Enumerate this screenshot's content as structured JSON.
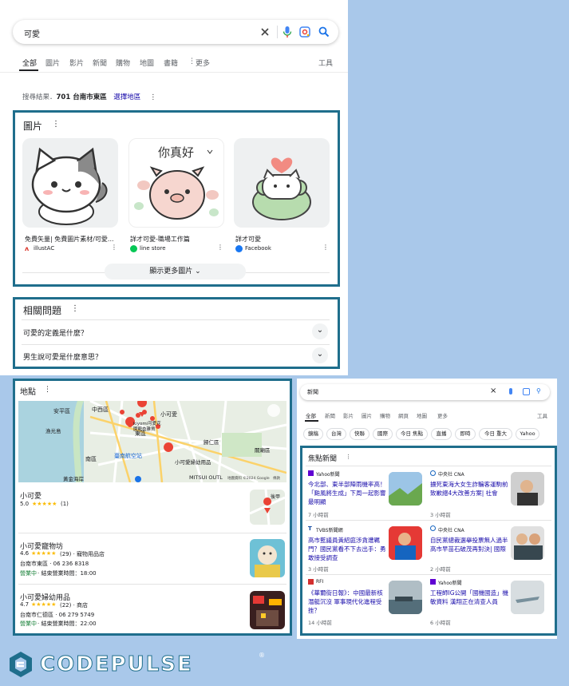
{
  "search": {
    "query": "可愛"
  },
  "tabs": [
    {
      "label": "全部"
    },
    {
      "label": "圖片"
    },
    {
      "label": "影片"
    },
    {
      "label": "新聞"
    },
    {
      "label": "購物"
    },
    {
      "label": "地圖"
    },
    {
      "label": "書籍"
    },
    {
      "label": "更多"
    }
  ],
  "tools_label": "工具",
  "location": {
    "prefix": "搜尋結果．",
    "place": "701 台南市東區",
    "change": "選擇地區"
  },
  "images": {
    "heading": "圖片",
    "cards": [
      {
        "title": "免費矢量| 免費圖片素材/可愛...",
        "source": "illustAC",
        "art_text": ""
      },
      {
        "title": "詳才可愛-職場工作篇",
        "source": "line store",
        "art_text": "你真好"
      },
      {
        "title": "詳才可愛",
        "source": "Facebook",
        "art_text": ""
      }
    ],
    "more": "顯示更多圖片"
  },
  "questions": {
    "heading": "相關問題",
    "items": [
      {
        "q": "可愛的定義是什麼？"
      },
      {
        "q": "男生說可愛是什麼意思？"
      }
    ]
  },
  "places": {
    "heading": "地點",
    "map_labels": [
      "安平區",
      "中西區",
      "小可愛",
      "東區",
      "漁光島",
      "kiyomi可愛花園寵衣雜貨",
      "臺南航空站",
      "南區",
      "小可愛婦幼用品",
      "關廟區",
      "歸仁區",
      "黃金海岸",
      "MITSUI OUTL"
    ],
    "map_footer": "地圖資料 ©2024 Google　條款",
    "items": [
      {
        "name": "小可愛",
        "rating": "5.0",
        "stars": "★★★★★",
        "count": "(1)",
        "lines": [],
        "open": "",
        "hours": "",
        "thumb_text": "後甲"
      },
      {
        "name": "小可愛寵物坊",
        "rating": "4.6",
        "stars": "★★★★★",
        "count": "(29) · 寵物用品店",
        "lines": [
          "台南市東區 · 06 236 8318"
        ],
        "open": "營業中",
        "hours": " · 結束營業時間：18:00",
        "thumb_text": ""
      },
      {
        "name": "小可愛婦幼用品",
        "rating": "4.7",
        "stars": "★★★★★",
        "count": "(22) · 商店",
        "lines": [
          "台南市仁德區 · 06 279 5749"
        ],
        "open": "營業中",
        "hours": " · 結束營業時間：22:00",
        "thumb_text": ""
      }
    ]
  },
  "news_panel": {
    "query": "新聞",
    "tabs": [
      "全部",
      "新聞",
      "影片",
      "圖片",
      "購物",
      "網頁",
      "地圖",
      "更多"
    ],
    "tools": "工具",
    "chips": [
      "鏡稿",
      "台灣",
      "快聯",
      "國際",
      "今日 焦點",
      "直播",
      "即時",
      "今日 重大",
      "Yahoo"
    ],
    "heading": "焦點新聞",
    "articles": [
      {
        "source": "Yahoo新聞",
        "title": "今北部、東半部陣雨機率高！「颱風將生成」下周一起影響最明顯",
        "time": "7 小時前",
        "color": "#6001d2"
      },
      {
        "source": "中央社 CNA",
        "title": "擄死東海大女生詐騙客運駒前致歉總4大改善方案| 社會",
        "time": "3 小時前",
        "color": "#1565c0"
      },
      {
        "source": "TVBS新聞網",
        "title": "高市藍議員黃紹庭涉貪遭羈門？國民黨看不下去出手：勇敢接受調查",
        "time": "3 小時前",
        "color": "#0d47a1"
      },
      {
        "source": "中央社 CNA",
        "title": "自民黨總裁選舉投票無人過半高市早苗石破茂再對決| 國際",
        "time": "2 小時前",
        "color": "#1565c0"
      },
      {
        "source": "RFI",
        "title": "《華爾街日報》：中國最新核潛艇沉沒 軍事現代化進程受挫？",
        "time": "14 小時前",
        "color": "#d32f2f"
      },
      {
        "source": "Yahoo新聞",
        "title": "工程師IG公開「國機國造」機敏資料 漢翔正在清查人員",
        "time": "6 小時前",
        "color": "#6001d2"
      }
    ]
  },
  "brand": {
    "name": "CODEPULSE"
  },
  "colors": {
    "frame": "#1f6e8c",
    "link": "#1a0dab",
    "background": "#a9c8ea",
    "open": "#188038"
  }
}
